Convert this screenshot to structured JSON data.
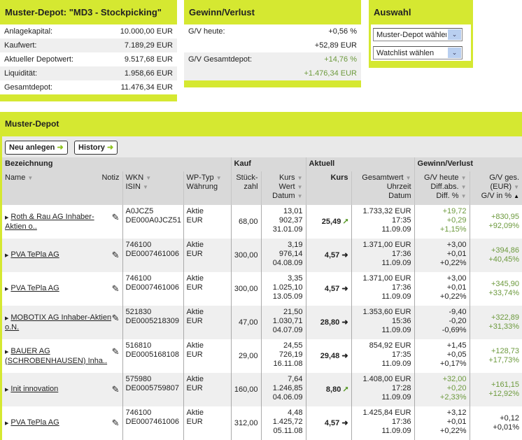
{
  "summary": {
    "title": "Muster-Depot: \"MD3 - Stockpicking\"",
    "rows": [
      {
        "label": "Anlagekapital:",
        "value": "10.000,00 EUR"
      },
      {
        "label": "Kaufwert:",
        "value": "7.189,29 EUR"
      },
      {
        "label": "Aktueller Depotwert:",
        "value": "9.517,68 EUR"
      },
      {
        "label": "Liquidität:",
        "value": "1.958,66 EUR"
      },
      {
        "label": "Gesamtdepot:",
        "value": "11.476,34 EUR"
      }
    ]
  },
  "gv": {
    "title": "Gewinn/Verlust",
    "today_label": "G/V heute:",
    "today_pct": "+0,56 %",
    "today_abs": "+52,89 EUR",
    "total_label": "G/V Gesamtdepot:",
    "total_pct": "+14,76 %",
    "total_abs": "+1.476,34 EUR"
  },
  "auswahl": {
    "title": "Auswahl",
    "depot_select": "Muster-Depot wählen",
    "watchlist_select": "Watchlist wählen"
  },
  "depot": {
    "title": "Muster-Depot",
    "new_button": "Neu anlegen",
    "history_button": "History",
    "headers": {
      "bezeichnung": "Bezeichnung",
      "kauf": "Kauf",
      "aktuell": "Aktuell",
      "gv": "Gewinn/Verlust",
      "name": "Name",
      "notiz": "Notiz",
      "wkn": "WKN",
      "isin": "ISIN",
      "wptyp": "WP-Typ",
      "waehrung": "Währung",
      "stueck1": "Stück-",
      "stueck2": "zahl",
      "kurs": "Kurs",
      "wert": "Wert",
      "datum": "Datum",
      "akurs": "Kurs",
      "gesamtwert": "Gesamtwert",
      "uhrzeit": "Uhrzeit",
      "adatum": "Datum",
      "gvheute": "G/V heute",
      "diffabs": "Diff.abs.",
      "diffpct": "Diff. %",
      "gvges": "G/V ges.",
      "eur": "(EUR)",
      "gvpct": "G/V in %"
    },
    "rows": [
      {
        "name": "Roth & Rau AG Inhaber-Aktien o..",
        "wkn": "A0JCZ5",
        "isin": "DE000A0JCZ51",
        "typ": "Aktie",
        "cur": "EUR",
        "stueck": "68,00",
        "kkurs": "13,01",
        "kwert": "902,37",
        "kdatum": "31.01.09",
        "akurs": "25,49",
        "trend": "up",
        "gesamt": "1.733,32 EUR",
        "zeit": "17:35",
        "adatum": "11.09.09",
        "gvh": "+19,72",
        "dabs": "+0,29",
        "dpct": "+1,15%",
        "hgreen": true,
        "gvg": "+830,95",
        "gvp": "+92,09%",
        "ggreen": true
      },
      {
        "name": "PVA TePla AG",
        "wkn": "746100",
        "isin": "DE0007461006",
        "typ": "Aktie",
        "cur": "EUR",
        "stueck": "300,00",
        "kkurs": "3,19",
        "kwert": "976,14",
        "kdatum": "04.08.09",
        "akurs": "4,57",
        "trend": "flat",
        "gesamt": "1.371,00 EUR",
        "zeit": "17:36",
        "adatum": "11.09.09",
        "gvh": "+3,00",
        "dabs": "+0,01",
        "dpct": "+0,22%",
        "hgreen": false,
        "gvg": "+394,86",
        "gvp": "+40,45%",
        "ggreen": true
      },
      {
        "name": "PVA TePla AG",
        "wkn": "746100",
        "isin": "DE0007461006",
        "typ": "Aktie",
        "cur": "EUR",
        "stueck": "300,00",
        "kkurs": "3,35",
        "kwert": "1.025,10",
        "kdatum": "13.05.09",
        "akurs": "4,57",
        "trend": "flat",
        "gesamt": "1.371,00 EUR",
        "zeit": "17:36",
        "adatum": "11.09.09",
        "gvh": "+3,00",
        "dabs": "+0,01",
        "dpct": "+0,22%",
        "hgreen": false,
        "gvg": "+345,90",
        "gvp": "+33,74%",
        "ggreen": true
      },
      {
        "name": "MOBOTIX AG Inhaber-Aktien o.N.",
        "wkn": "521830",
        "isin": "DE0005218309",
        "typ": "Aktie",
        "cur": "EUR",
        "stueck": "47,00",
        "kkurs": "21,50",
        "kwert": "1.030,71",
        "kdatum": "04.07.09",
        "akurs": "28,80",
        "trend": "flat",
        "gesamt": "1.353,60 EUR",
        "zeit": "15:36",
        "adatum": "11.09.09",
        "gvh": "-9,40",
        "dabs": "-0,20",
        "dpct": "-0,69%",
        "hgreen": false,
        "gvg": "+322,89",
        "gvp": "+31,33%",
        "ggreen": true
      },
      {
        "name": "BAUER AG (SCHROBENHAUSEN) Inha..",
        "wkn": "516810",
        "isin": "DE0005168108",
        "typ": "Aktie",
        "cur": "EUR",
        "stueck": "29,00",
        "kkurs": "24,55",
        "kwert": "726,19",
        "kdatum": "16.11.08",
        "akurs": "29,48",
        "trend": "flat",
        "gesamt": "854,92 EUR",
        "zeit": "17:35",
        "adatum": "11.09.09",
        "gvh": "+1,45",
        "dabs": "+0,05",
        "dpct": "+0,17%",
        "hgreen": false,
        "gvg": "+128,73",
        "gvp": "+17,73%",
        "ggreen": true
      },
      {
        "name": "Init innovation",
        "wkn": "575980",
        "isin": "DE0005759807",
        "typ": "Aktie",
        "cur": "EUR",
        "stueck": "160,00",
        "kkurs": "7,64",
        "kwert": "1.246,85",
        "kdatum": "04.06.09",
        "akurs": "8,80",
        "trend": "up",
        "gesamt": "1.408,00 EUR",
        "zeit": "17:28",
        "adatum": "11.09.09",
        "gvh": "+32,00",
        "dabs": "+0,20",
        "dpct": "+2,33%",
        "hgreen": true,
        "gvg": "+161,15",
        "gvp": "+12,92%",
        "ggreen": true
      },
      {
        "name": "PVA TePla AG",
        "wkn": "746100",
        "isin": "DE0007461006",
        "typ": "Aktie",
        "cur": "EUR",
        "stueck": "312,00",
        "kkurs": "4,48",
        "kwert": "1.425,72",
        "kdatum": "05.11.08",
        "akurs": "4,57",
        "trend": "flat",
        "gesamt": "1.425,84 EUR",
        "zeit": "17:36",
        "adatum": "11.09.09",
        "gvh": "+3,12",
        "dabs": "+0,01",
        "dpct": "+0,22%",
        "hgreen": false,
        "gvg": "+0,12",
        "gvp": "+0,01%",
        "ggreen": false
      }
    ]
  }
}
